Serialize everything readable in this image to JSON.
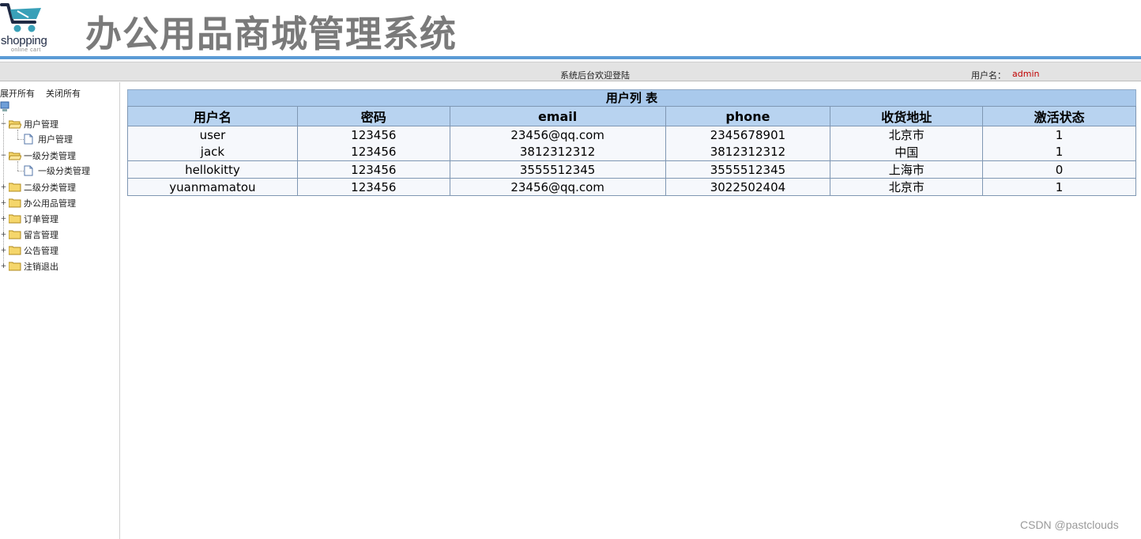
{
  "header": {
    "logo_text": "shopping",
    "logo_subtext": "online cart",
    "site_title": "办公用品商城管理系统",
    "accent_color": "#5b9bd5"
  },
  "welcome_bar": {
    "welcome_text": "系统后台欢迎登陆",
    "user_label": "用户名：",
    "user_name": "admin"
  },
  "sidebar": {
    "expand_all": "展开所有",
    "collapse_all": "关闭所有",
    "root_icon": "computer-icon",
    "items": [
      {
        "label": "用户管理",
        "expanded": true,
        "children": [
          {
            "label": "用户管理"
          }
        ]
      },
      {
        "label": "一级分类管理",
        "expanded": true,
        "children": [
          {
            "label": "一级分类管理"
          }
        ]
      },
      {
        "label": "二级分类管理",
        "expanded": false
      },
      {
        "label": "办公用品管理",
        "expanded": false
      },
      {
        "label": "订单管理",
        "expanded": false
      },
      {
        "label": "留言管理",
        "expanded": false
      },
      {
        "label": "公告管理",
        "expanded": false
      },
      {
        "label": "注销退出",
        "expanded": false
      }
    ]
  },
  "user_table": {
    "caption": "用户列 表",
    "columns": [
      "用户名",
      "密码",
      "email",
      "phone",
      "收货地址",
      "激活状态"
    ],
    "rows": [
      [
        "user",
        "123456",
        "23456@qq.com",
        "2345678901",
        "北京市",
        "1"
      ],
      [
        "jack",
        "123456",
        "3812312312",
        "3812312312",
        "中国",
        "1"
      ],
      [
        "hellokitty",
        "123456",
        "3555512345",
        "3555512345",
        "上海市",
        "0"
      ],
      [
        "yuanmamatou",
        "123456",
        "23456@qq.com",
        "3022502404",
        "北京市",
        "1"
      ]
    ]
  },
  "watermark": "CSDN @pastclouds"
}
